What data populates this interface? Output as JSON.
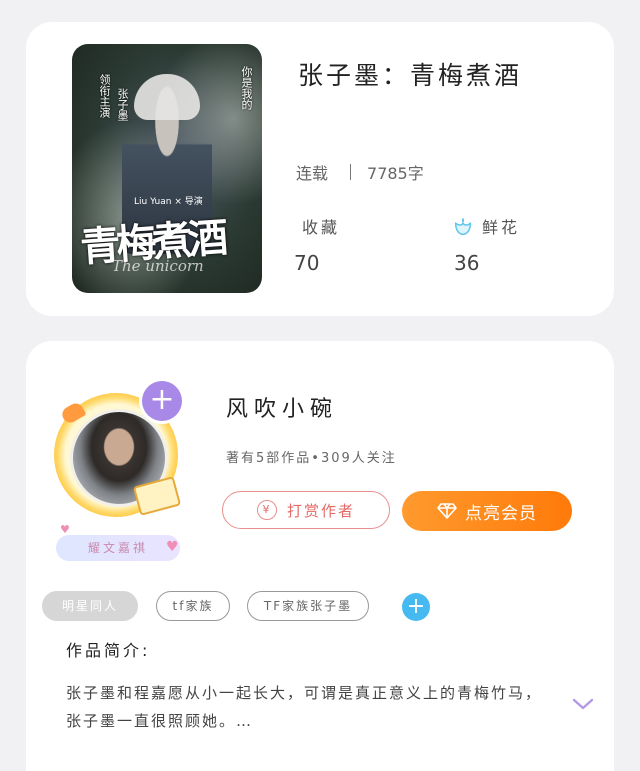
{
  "book": {
    "title": "张子墨：青梅煮酒",
    "status": "连载",
    "word_count": "7785字",
    "favorites_label": "收藏",
    "favorites_value": "70",
    "flowers_label": "鲜花",
    "flowers_value": "36",
    "cover": {
      "calligraphy_title": "青梅煮酒",
      "english_title": "The unicorn",
      "vertical_left": "领衔主演",
      "vertical_mid": "张子墨",
      "vertical_right": "你是我的",
      "director": "Liu Yuan × 导演"
    }
  },
  "author": {
    "name": "风吹小碗",
    "stats": "著有5部作品•309人关注",
    "badge": "耀文嘉祺",
    "tip_button": "打赏作者",
    "vip_button": "点亮会员"
  },
  "tags": [
    "明星同人",
    "tf家族",
    "TF家族张子墨"
  ],
  "intro": {
    "title": "作品简介:",
    "text": "张子墨和程嘉愿从小一起长大，可谓是真正意义上的青梅竹马，张子墨一直很照顾她。…"
  },
  "colors": {
    "vip_orange": "#ff8a1c",
    "tip_red": "#e36a67",
    "add_blue": "#46b9f0",
    "plus_purple": "#a889e8"
  },
  "icons": [
    "flower-icon",
    "yen-icon",
    "diamond-icon",
    "plus-icon",
    "chevron-down-icon"
  ]
}
